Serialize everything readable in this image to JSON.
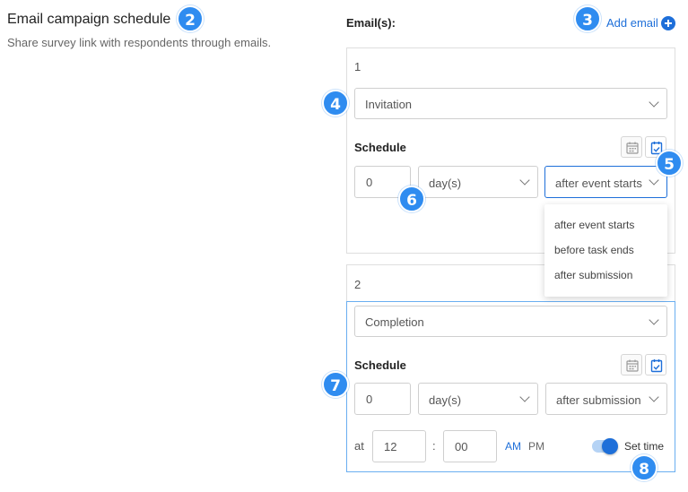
{
  "header": {
    "title": "Email campaign schedule",
    "subtitle": "Share survey link with respondents through emails."
  },
  "emails": {
    "label": "Email(s):",
    "add_label": "Add email"
  },
  "badges": [
    "2",
    "3",
    "4",
    "5",
    "6",
    "7",
    "8"
  ],
  "cards": [
    {
      "number": "1",
      "template": "Invitation",
      "schedule_label": "Schedule",
      "offset": "0",
      "unit": "day(s)",
      "trigger": "after event starts",
      "trigger_options": [
        "after event starts",
        "before task ends",
        "after submission"
      ]
    },
    {
      "number": "2",
      "template": "Completion",
      "schedule_label": "Schedule",
      "offset": "0",
      "unit": "day(s)",
      "trigger": "after submission",
      "time": {
        "at_label": "at",
        "hour": "12",
        "separator": ":",
        "minute": "00",
        "am_label": "AM",
        "pm_label": "PM",
        "set_time_label": "Set time",
        "set_time_enabled": true
      }
    }
  ],
  "colors": {
    "accent": "#1e6fd9",
    "badge": "#2f8cf0",
    "active_border": "#6aaef0"
  },
  "icons": [
    "calendar-icon",
    "calendar-check-icon",
    "chevron-down-icon",
    "plus-circle-icon"
  ]
}
